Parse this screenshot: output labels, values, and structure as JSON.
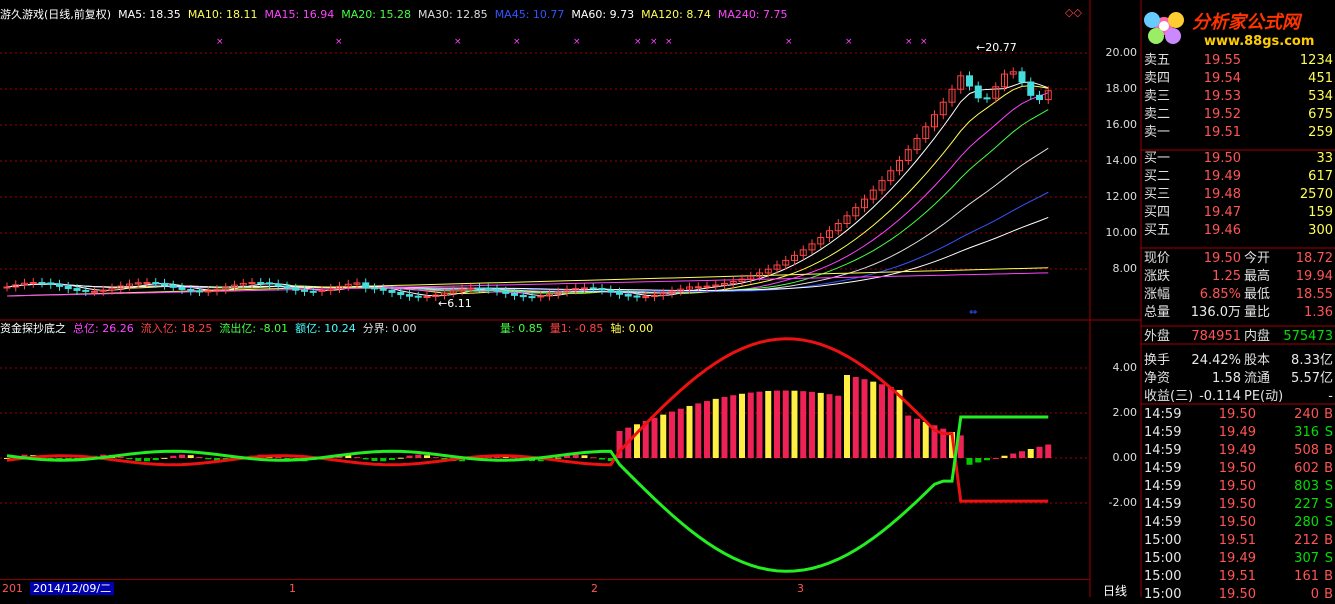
{
  "header": {
    "stock_title": "游久游戏(日线,前复权)",
    "ma": [
      {
        "label": "MA5: 18.35",
        "color": "#ffffff"
      },
      {
        "label": "MA10: 18.11",
        "color": "#ffff55"
      },
      {
        "label": "MA15: 16.94",
        "color": "#ff44ff"
      },
      {
        "label": "MA20: 15.28",
        "color": "#44ff44"
      },
      {
        "label": "MA30: 12.85",
        "color": "#dddddd"
      },
      {
        "label": "MA45: 10.77",
        "color": "#3355ff"
      },
      {
        "label": "MA60: 9.73",
        "color": "#ffffff"
      },
      {
        "label": "MA120: 8.74",
        "color": "#ffff55"
      },
      {
        "label": "MA240: 7.75",
        "color": "#ff44ff"
      }
    ]
  },
  "indicator": {
    "name": "资金探抄底之",
    "values": [
      {
        "label": "总亿: 26.26",
        "color": "#ff44ff"
      },
      {
        "label": "流入亿: 18.25",
        "color": "#ff4444"
      },
      {
        "label": "流出亿: -8.01",
        "color": "#44ff44"
      },
      {
        "label": "额亿: 10.24",
        "color": "#44ffff"
      },
      {
        "label": "分界: 0.00",
        "color": "#dddddd"
      }
    ],
    "values2": [
      {
        "label": "量: 0.85",
        "color": "#44ff44"
      },
      {
        "label": "量1: -0.85",
        "color": "#ff4444"
      },
      {
        "label": "轴: 0.00",
        "color": "#ffff55"
      }
    ]
  },
  "price_axis": [
    "20.00",
    "18.00",
    "16.00",
    "14.00",
    "12.00",
    "10.00",
    "8.00"
  ],
  "ind_axis": [
    "4.00",
    "2.00",
    "0.00",
    "-2.00"
  ],
  "annotations": {
    "high": "20.77",
    "low": "6.11"
  },
  "timebar": {
    "date": "2014/12/09/二",
    "left": "201",
    "ticks": [
      "1",
      "2",
      "3"
    ],
    "period": "日线"
  },
  "logo": {
    "title": "分析家公式网",
    "url": "www.88gs.com"
  },
  "orderbook": {
    "sell": [
      {
        "label": "卖五",
        "price": "19.55",
        "vol": "1234"
      },
      {
        "label": "卖四",
        "price": "19.54",
        "vol": "451"
      },
      {
        "label": "卖三",
        "price": "19.53",
        "vol": "534"
      },
      {
        "label": "卖二",
        "price": "19.52",
        "vol": "675"
      },
      {
        "label": "卖一",
        "price": "19.51",
        "vol": "259"
      }
    ],
    "buy": [
      {
        "label": "买一",
        "price": "19.50",
        "vol": "33"
      },
      {
        "label": "买二",
        "price": "19.49",
        "vol": "617"
      },
      {
        "label": "买三",
        "price": "19.48",
        "vol": "2570"
      },
      {
        "label": "买四",
        "price": "19.47",
        "vol": "159"
      },
      {
        "label": "买五",
        "price": "19.46",
        "vol": "300"
      }
    ]
  },
  "quote": [
    {
      "l1": "现价",
      "v1": "19.50",
      "c1": "red",
      "l2": "今开",
      "v2": "18.72",
      "c2": "red"
    },
    {
      "l1": "涨跌",
      "v1": "1.25",
      "c1": "red",
      "l2": "最高",
      "v2": "19.94",
      "c2": "red"
    },
    {
      "l1": "涨幅",
      "v1": "6.85%",
      "c1": "red",
      "l2": "最低",
      "v2": "18.55",
      "c2": "red"
    },
    {
      "l1": "总量",
      "v1": "136.0万",
      "c1": "wht",
      "l2": "量比",
      "v2": "1.36",
      "c2": "red"
    },
    {
      "l1": "外盘",
      "v1": "784951",
      "c1": "red",
      "l2": "内盘",
      "v2": "575473",
      "c2": "grn"
    },
    {
      "l1": "换手",
      "v1": "24.42%",
      "c1": "wht",
      "l2": "股本",
      "v2": "8.33亿",
      "c2": "wht"
    },
    {
      "l1": "净资",
      "v1": "1.58",
      "c1": "wht",
      "l2": "流通",
      "v2": "5.57亿",
      "c2": "wht"
    },
    {
      "l1": "收益(三)",
      "v1": "-0.114",
      "c1": "wht",
      "l2": "PE(动)",
      "v2": "-",
      "c2": "wht"
    }
  ],
  "ticks": [
    {
      "time": "14:59",
      "price": "19.50",
      "vol": "240",
      "flag": "B"
    },
    {
      "time": "14:59",
      "price": "19.49",
      "vol": "316",
      "flag": "S"
    },
    {
      "time": "14:59",
      "price": "19.49",
      "vol": "508",
      "flag": "B"
    },
    {
      "time": "14:59",
      "price": "19.50",
      "vol": "602",
      "flag": "B"
    },
    {
      "time": "14:59",
      "price": "19.50",
      "vol": "803",
      "flag": "S"
    },
    {
      "time": "14:59",
      "price": "19.50",
      "vol": "227",
      "flag": "S"
    },
    {
      "time": "14:59",
      "price": "19.50",
      "vol": "280",
      "flag": "S"
    },
    {
      "time": "15:00",
      "price": "19.51",
      "vol": "212",
      "flag": "B"
    },
    {
      "time": "15:00",
      "price": "19.49",
      "vol": "307",
      "flag": "S"
    },
    {
      "time": "15:00",
      "price": "19.51",
      "vol": "161",
      "flag": "B"
    },
    {
      "time": "15:00",
      "price": "19.50",
      "vol": "0",
      "flag": "B"
    }
  ]
}
